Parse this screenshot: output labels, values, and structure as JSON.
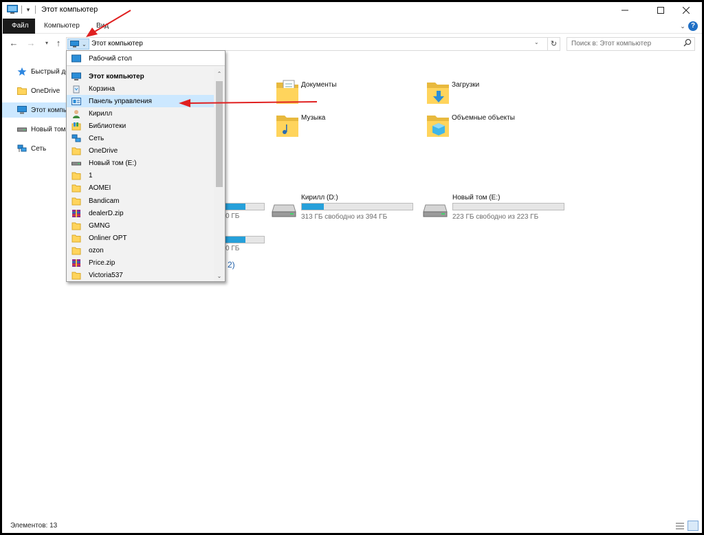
{
  "window": {
    "title": "Этот компьютер"
  },
  "ribbon": {
    "tabs": [
      "Файл",
      "Компьютер",
      "Вид"
    ],
    "help": "?"
  },
  "navbar": {
    "address_text": "Этот компьютер",
    "search_placeholder": "Поиск в: Этот компьютер"
  },
  "sidebar": {
    "items": [
      {
        "label": "Быстрый доступ",
        "icon": "star-icon"
      },
      {
        "label": "OneDrive",
        "icon": "folder-icon"
      },
      {
        "label": "Этот компьютер",
        "icon": "computer-icon",
        "selected": true
      },
      {
        "label": "Новый том (E:)",
        "icon": "drive-icon"
      },
      {
        "label": "Сеть",
        "icon": "network-icon"
      }
    ]
  },
  "content": {
    "folders": [
      {
        "label": "Документы",
        "icon": "documents-folder-icon"
      },
      {
        "label": "Загрузки",
        "icon": "downloads-folder-icon"
      },
      {
        "label": "Музыка",
        "icon": "music-folder-icon"
      },
      {
        "label": "Объемные объекты",
        "icon": "3d-objects-folder-icon"
      }
    ],
    "drives": [
      {
        "name": "Кирилл (D:)",
        "free_text": "313 ГБ свободно из 394 ГБ",
        "used_fraction": 0.2
      },
      {
        "name": "Новый том (E:)",
        "free_text": "223 ГБ свободно из 223 ГБ",
        "used_fraction": 0.0
      }
    ],
    "partial_texts": [
      "0 ГБ",
      "0 ГБ"
    ],
    "partial_link": "2)"
  },
  "dropdown": {
    "top_item": "Рабочий стол",
    "items": [
      {
        "label": "Этот компьютер",
        "icon": "computer-icon",
        "bold": true
      },
      {
        "label": "Корзина",
        "icon": "recycle-bin-icon"
      },
      {
        "label": "Панель управления",
        "icon": "control-panel-icon",
        "highlighted": true
      },
      {
        "label": "Кирилл",
        "icon": "user-icon"
      },
      {
        "label": "Библиотеки",
        "icon": "libraries-icon"
      },
      {
        "label": "Сеть",
        "icon": "network-icon"
      },
      {
        "label": "OneDrive",
        "icon": "folder-icon"
      },
      {
        "label": "Новый том (E:)",
        "icon": "drive-icon"
      },
      {
        "label": "1",
        "icon": "folder-icon"
      },
      {
        "label": "AOMEI",
        "icon": "folder-icon"
      },
      {
        "label": "Bandicam",
        "icon": "folder-icon"
      },
      {
        "label": "dealerD.zip",
        "icon": "zip-archive-icon"
      },
      {
        "label": "GMNG",
        "icon": "folder-icon"
      },
      {
        "label": "Onliner OPT",
        "icon": "folder-icon"
      },
      {
        "label": "ozon",
        "icon": "folder-icon"
      },
      {
        "label": "Price.zip",
        "icon": "zip-archive-icon"
      },
      {
        "label": "Victoria537",
        "icon": "folder-icon"
      }
    ]
  },
  "status": {
    "count": "Элементов: 13"
  },
  "colors": {
    "accent": "#26a0da",
    "selection": "#cce8ff",
    "annotation": "#e02020"
  }
}
